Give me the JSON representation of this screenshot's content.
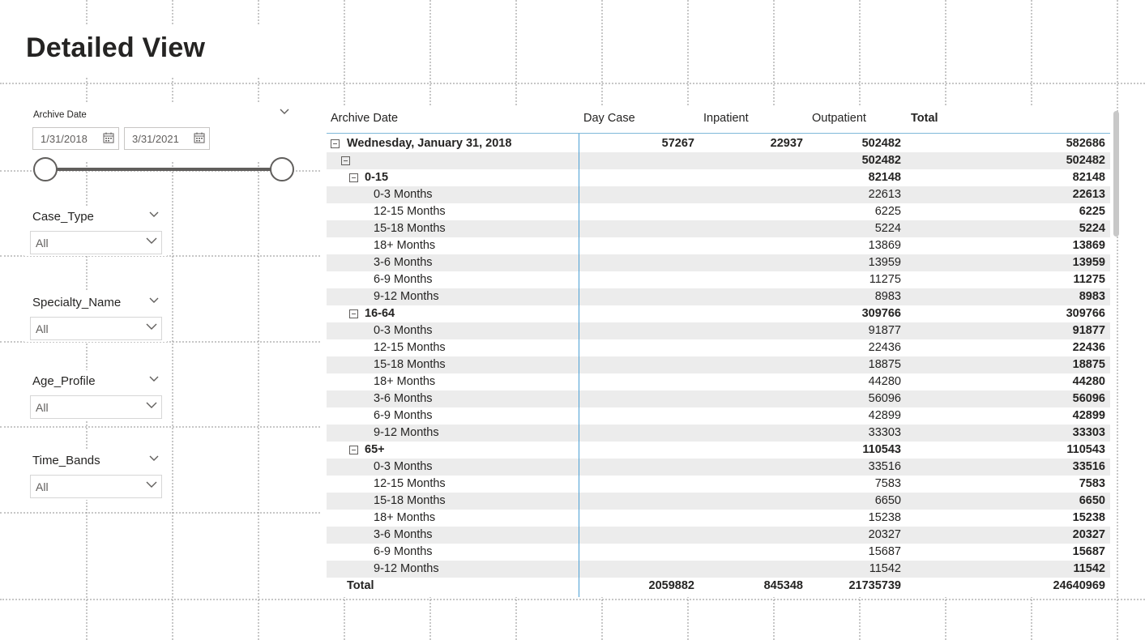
{
  "page": {
    "title": "Detailed View"
  },
  "slicers": {
    "archive_date": {
      "title": "Archive Date",
      "start": "1/31/2018",
      "end": "3/31/2021",
      "range_start_fraction": 0.0,
      "range_end_fraction": 1.0
    },
    "case_type": {
      "title": "Case_Type",
      "value": "All"
    },
    "specialty_name": {
      "title": "Specialty_Name",
      "value": "All"
    },
    "age_profile": {
      "title": "Age_Profile",
      "value": "All"
    },
    "time_bands": {
      "title": "Time_Bands",
      "value": "All"
    }
  },
  "matrix": {
    "headers": [
      "Archive Date",
      "Day Case",
      "Inpatient",
      "Outpatient",
      "Total"
    ],
    "rows": [
      {
        "label": "Wednesday, January 31, 2018",
        "level": 0,
        "toggle": true,
        "bold": true,
        "day_case": "57267",
        "inpatient": "22937",
        "outpatient": "502482",
        "total": "582686"
      },
      {
        "label": "",
        "level": 1,
        "toggle": true,
        "bold": true,
        "day_case": "",
        "inpatient": "",
        "outpatient": "502482",
        "total": "502482"
      },
      {
        "label": "0-15",
        "level": 2,
        "toggle": true,
        "bold": true,
        "day_case": "",
        "inpatient": "",
        "outpatient": "82148",
        "total": "82148"
      },
      {
        "label": "0-3 Months",
        "level": 3,
        "toggle": false,
        "bold": false,
        "day_case": "",
        "inpatient": "",
        "outpatient": "22613",
        "total": "22613"
      },
      {
        "label": "12-15 Months",
        "level": 3,
        "toggle": false,
        "bold": false,
        "day_case": "",
        "inpatient": "",
        "outpatient": "6225",
        "total": "6225"
      },
      {
        "label": "15-18 Months",
        "level": 3,
        "toggle": false,
        "bold": false,
        "day_case": "",
        "inpatient": "",
        "outpatient": "5224",
        "total": "5224"
      },
      {
        "label": "18+ Months",
        "level": 3,
        "toggle": false,
        "bold": false,
        "day_case": "",
        "inpatient": "",
        "outpatient": "13869",
        "total": "13869"
      },
      {
        "label": "3-6 Months",
        "level": 3,
        "toggle": false,
        "bold": false,
        "day_case": "",
        "inpatient": "",
        "outpatient": "13959",
        "total": "13959"
      },
      {
        "label": "6-9 Months",
        "level": 3,
        "toggle": false,
        "bold": false,
        "day_case": "",
        "inpatient": "",
        "outpatient": "11275",
        "total": "11275"
      },
      {
        "label": "9-12 Months",
        "level": 3,
        "toggle": false,
        "bold": false,
        "day_case": "",
        "inpatient": "",
        "outpatient": "8983",
        "total": "8983"
      },
      {
        "label": "16-64",
        "level": 2,
        "toggle": true,
        "bold": true,
        "day_case": "",
        "inpatient": "",
        "outpatient": "309766",
        "total": "309766"
      },
      {
        "label": "0-3 Months",
        "level": 3,
        "toggle": false,
        "bold": false,
        "day_case": "",
        "inpatient": "",
        "outpatient": "91877",
        "total": "91877"
      },
      {
        "label": "12-15 Months",
        "level": 3,
        "toggle": false,
        "bold": false,
        "day_case": "",
        "inpatient": "",
        "outpatient": "22436",
        "total": "22436"
      },
      {
        "label": "15-18 Months",
        "level": 3,
        "toggle": false,
        "bold": false,
        "day_case": "",
        "inpatient": "",
        "outpatient": "18875",
        "total": "18875"
      },
      {
        "label": "18+ Months",
        "level": 3,
        "toggle": false,
        "bold": false,
        "day_case": "",
        "inpatient": "",
        "outpatient": "44280",
        "total": "44280"
      },
      {
        "label": "3-6 Months",
        "level": 3,
        "toggle": false,
        "bold": false,
        "day_case": "",
        "inpatient": "",
        "outpatient": "56096",
        "total": "56096"
      },
      {
        "label": "6-9 Months",
        "level": 3,
        "toggle": false,
        "bold": false,
        "day_case": "",
        "inpatient": "",
        "outpatient": "42899",
        "total": "42899"
      },
      {
        "label": "9-12 Months",
        "level": 3,
        "toggle": false,
        "bold": false,
        "day_case": "",
        "inpatient": "",
        "outpatient": "33303",
        "total": "33303"
      },
      {
        "label": "65+",
        "level": 2,
        "toggle": true,
        "bold": true,
        "day_case": "",
        "inpatient": "",
        "outpatient": "110543",
        "total": "110543"
      },
      {
        "label": "0-3 Months",
        "level": 3,
        "toggle": false,
        "bold": false,
        "day_case": "",
        "inpatient": "",
        "outpatient": "33516",
        "total": "33516"
      },
      {
        "label": "12-15 Months",
        "level": 3,
        "toggle": false,
        "bold": false,
        "day_case": "",
        "inpatient": "",
        "outpatient": "7583",
        "total": "7583"
      },
      {
        "label": "15-18 Months",
        "level": 3,
        "toggle": false,
        "bold": false,
        "day_case": "",
        "inpatient": "",
        "outpatient": "6650",
        "total": "6650"
      },
      {
        "label": "18+ Months",
        "level": 3,
        "toggle": false,
        "bold": false,
        "day_case": "",
        "inpatient": "",
        "outpatient": "15238",
        "total": "15238"
      },
      {
        "label": "3-6 Months",
        "level": 3,
        "toggle": false,
        "bold": false,
        "day_case": "",
        "inpatient": "",
        "outpatient": "20327",
        "total": "20327"
      },
      {
        "label": "6-9 Months",
        "level": 3,
        "toggle": false,
        "bold": false,
        "day_case": "",
        "inpatient": "",
        "outpatient": "15687",
        "total": "15687"
      },
      {
        "label": "9-12 Months",
        "level": 3,
        "toggle": false,
        "bold": false,
        "day_case": "",
        "inpatient": "",
        "outpatient": "11542",
        "total": "11542"
      }
    ],
    "total_row": {
      "label": "Total",
      "day_case": "2059882",
      "inpatient": "845348",
      "outpatient": "21735739",
      "total": "24640969"
    }
  },
  "icons": {
    "calendar": "calendar-icon",
    "chevron": "chevron-down-icon",
    "collapse": "collapse-toggle-icon"
  },
  "colors": {
    "accent_line": "#4a9fd4",
    "row_shade": "#ececec",
    "text": "#252423"
  }
}
